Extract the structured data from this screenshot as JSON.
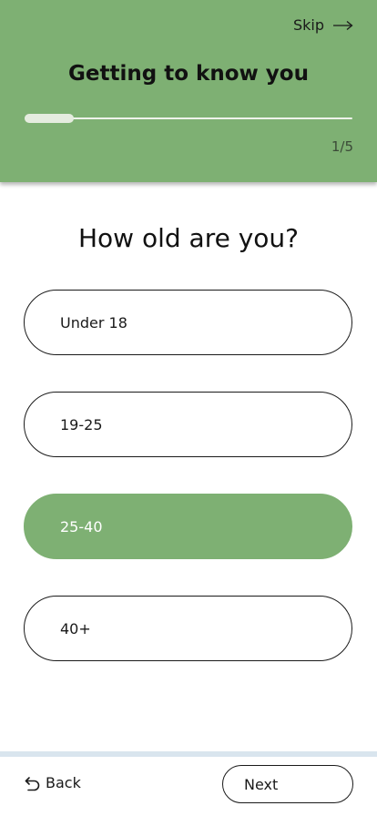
{
  "header": {
    "skip_label": "Skip",
    "title": "Getting to know you",
    "progress": {
      "current": 1,
      "total": 5,
      "label": "1/5",
      "fraction": 0.15
    },
    "background_color": "#7eb073"
  },
  "question": {
    "text": "How old are you?",
    "options": [
      {
        "label": "Under 18",
        "selected": false
      },
      {
        "label": "19-25",
        "selected": false
      },
      {
        "label": "25-40",
        "selected": true
      },
      {
        "label": "40+",
        "selected": false
      }
    ]
  },
  "footer": {
    "back_label": "Back",
    "next_label": "Next"
  },
  "colors": {
    "accent": "#7eb073",
    "text": "#111111"
  },
  "icons": {
    "skip": "arrow-right-icon",
    "back": "undo-arrow-icon"
  }
}
